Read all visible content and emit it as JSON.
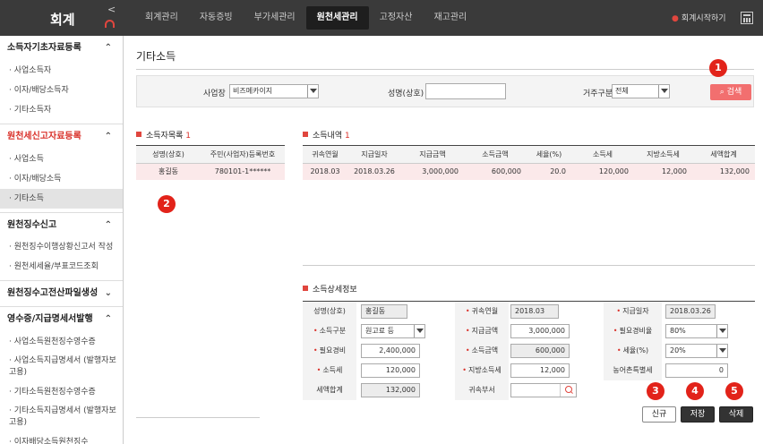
{
  "app": {
    "title": "회계"
  },
  "nav": {
    "items": [
      "회계관리",
      "자동증빙",
      "부가세관리",
      "원천세관리",
      "고정자산",
      "재고관리"
    ],
    "active_index": 3,
    "start_label": "회계시작하기"
  },
  "sidebar": {
    "sections": [
      {
        "title": "소득자기초자료등록",
        "items": [
          "사업소득자",
          "이자/배당소득자",
          "기타소득자"
        ]
      },
      {
        "title": "원천세신고자료등록",
        "items": [
          "사업소득",
          "이자/배당소득",
          "기타소득"
        ]
      },
      {
        "title": "원천징수신고",
        "items": [
          "원천징수이행상황신고서 작성",
          "원천세세율/부표코드조회"
        ]
      },
      {
        "title": "원천징수고전산파일생성"
      },
      {
        "title": "영수증/지급명세서발행",
        "items": [
          "사업소득원천징수영수증",
          "사업소득지급명세서 (발행자보고용)",
          "기타소득원천징수영수증",
          "기타소득지급명세서 (발행자보고용)",
          "이자배당소득원천징수"
        ]
      }
    ]
  },
  "page": {
    "title": "기타소득"
  },
  "search": {
    "business_label": "사업장",
    "business_value": "비즈메카이지",
    "name_label": "성명(상호)",
    "name_value": "",
    "residence_label": "거주구분",
    "residence_value": "전체",
    "search_button": "검색"
  },
  "earner_list": {
    "title": "소득자목록",
    "count": "1",
    "headers": [
      "성명(상호)",
      "주민(사업자)등록번호"
    ],
    "rows": [
      [
        "홍길동",
        "780101-1******"
      ]
    ]
  },
  "income_list": {
    "title": "소득내역",
    "count": "1",
    "headers": [
      "귀속연월",
      "지급일자",
      "지급금액",
      "소득금액",
      "세율(%)",
      "소득세",
      "지방소득세",
      "세액합계"
    ],
    "rows": [
      [
        "2018.03",
        "2018.03.26",
        "3,000,000",
        "600,000",
        "20.0",
        "120,000",
        "12,000",
        "132,000"
      ]
    ]
  },
  "detail": {
    "title": "소득상세정보",
    "name_label": "성명(상호)",
    "name_value": "홍길동",
    "period_label": "귀속연월",
    "period_value": "2018.03",
    "paydate_label": "지급일자",
    "paydate_value": "2018.03.26",
    "income_type_label": "소득구분",
    "income_type_value": "원고료 등",
    "pay_amount_label": "지급금액",
    "pay_amount_value": "3,000,000",
    "expense_rate_label": "필요경비율",
    "expense_rate_value": "80%",
    "expense_label": "필요경비",
    "expense_value": "2,400,000",
    "income_amount_label": "소득금액",
    "income_amount_value": "600,000",
    "tax_rate_label": "세율(%)",
    "tax_rate_value": "20%",
    "income_tax_label": "소득세",
    "income_tax_value": "120,000",
    "local_tax_label": "지방소득세",
    "local_tax_value": "12,000",
    "rural_tax_label": "농어촌특별세",
    "rural_tax_value": "0",
    "total_tax_label": "세액합계",
    "total_tax_value": "132,000",
    "dept_label": "귀속부서",
    "dept_value": ""
  },
  "actions": {
    "new": "신규",
    "save": "저장",
    "delete": "삭제"
  },
  "badges": [
    "1",
    "2",
    "3",
    "4",
    "5"
  ]
}
